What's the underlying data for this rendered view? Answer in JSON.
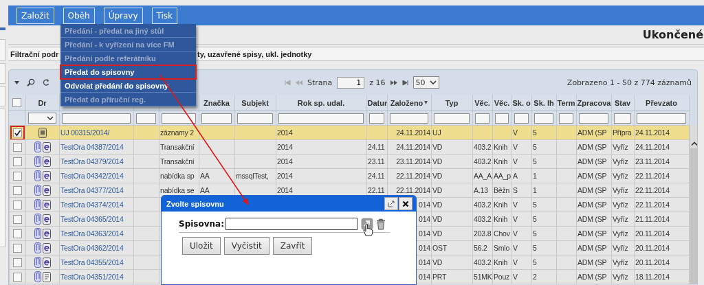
{
  "toolbar": {
    "buttons": [
      "Založit",
      "Oběh",
      "Úpravy",
      "Tisk"
    ]
  },
  "menu": {
    "items": [
      {
        "label": "Předání - předat na jiný stůl",
        "disabled": true,
        "selected": false
      },
      {
        "label": "Předání - k vyřízení na více FM",
        "disabled": true,
        "selected": false
      },
      {
        "label": "Předání podle referátníku",
        "disabled": true,
        "selected": false
      },
      {
        "label": "Předat do spisovny",
        "disabled": false,
        "selected": true
      },
      {
        "label": "Odvolat předání do spisovny",
        "disabled": false,
        "selected": false
      },
      {
        "label": "Předat do příruční reg.",
        "disabled": true,
        "selected": false
      }
    ]
  },
  "page_title": "Ukončené",
  "filter": {
    "parts": [
      "Filtrační podr",
      "ty, uzavřené spisy, ukl. jednotky"
    ]
  },
  "grid": {
    "pager": {
      "page_label": "Strana",
      "page": "1",
      "page_count": "z 16",
      "page_size": "50",
      "summary": "Zobrazeno 1 - 50 z 774 záznamů"
    },
    "columns": [
      {
        "kind": "checkbox",
        "checked": false
      },
      {
        "label": "Dr",
        "kind": "icons"
      },
      {
        "kind": "link"
      },
      {
        "kind": "text"
      },
      {
        "kind": "text"
      },
      {
        "label": "Značka",
        "kind": "text"
      },
      {
        "label": "Subjekt",
        "kind": "text"
      },
      {
        "label": "Rok sp. udal.",
        "kind": "text"
      },
      {
        "label": "Datur",
        "kind": "text"
      },
      {
        "label": "Založeno",
        "kind": "text",
        "sorted": true
      },
      {
        "label": "Typ",
        "kind": "text"
      },
      {
        "label": "Věc.",
        "kind": "text"
      },
      {
        "label": "Věc.",
        "kind": "text"
      },
      {
        "label": "Sk. o",
        "kind": "text"
      },
      {
        "label": "Sk. lh",
        "kind": "text"
      },
      {
        "label": "Term",
        "kind": "text"
      },
      {
        "label": "Zpracova",
        "kind": "text"
      },
      {
        "label": "Stav",
        "kind": "text"
      },
      {
        "label": "Převzato",
        "kind": "text"
      }
    ],
    "rows": [
      {
        "selected": true,
        "cells": [
          {
            "checked": true
          },
          {
            "icons": [
              {
                "kind": "unit"
              }
            ]
          },
          "UJ 00315/2014/",
          "",
          "záznamy 2",
          "",
          "",
          "2014",
          "",
          "24.11.2014",
          "UJ",
          "",
          "",
          "V",
          "5",
          "",
          "ADM (SP",
          "Přípra",
          "24.11.2014"
        ]
      },
      {
        "selected": false,
        "cells": [
          {
            "checked": false
          },
          {
            "icons": [
              {
                "kind": "clip"
              },
              {
                "kind": "e"
              }
            ]
          },
          "TestOra 04387/2014",
          "",
          "Transakční",
          "",
          "",
          "2014",
          "24.11",
          "24.11.2014",
          "VD",
          "403.2",
          "Knih",
          "V",
          "5",
          "",
          "ADM (SP",
          "Vyříz",
          "24.11.2014"
        ]
      },
      {
        "selected": false,
        "cells": [
          {
            "checked": false
          },
          {
            "icons": [
              {
                "kind": "clip"
              },
              {
                "kind": "e"
              }
            ]
          },
          "TestOra 04379/2014",
          "",
          "Transakční",
          "",
          "",
          "2014",
          "23.11",
          "23.11.2014",
          "VD",
          "403.2",
          "Knih",
          "V",
          "5",
          "",
          "ADM (SP",
          "Vyříz",
          "23.11.2014"
        ]
      },
      {
        "selected": false,
        "cells": [
          {
            "checked": false
          },
          {
            "icons": [
              {
                "kind": "clip"
              },
              {
                "kind": "e"
              }
            ]
          },
          "TestOra 04342/2014",
          "",
          "nabídka sp",
          "AA",
          "mssqlTest,",
          "2014",
          "24.11",
          "22.11.2014",
          "VD",
          "AA_A",
          "AA_p",
          "A",
          "1",
          "",
          "ADM (SP",
          "Vyříz",
          "22.11.2014"
        ]
      },
      {
        "selected": false,
        "cells": [
          {
            "checked": false
          },
          {
            "icons": [
              {
                "kind": "clip"
              },
              {
                "kind": "e"
              }
            ]
          },
          "TestOra 04377/2014",
          "",
          "nabídka se",
          "AA",
          "",
          "2014",
          "22.11",
          "22.11.2014",
          "VD",
          "A.13",
          "Běžn",
          "S",
          "1",
          "",
          "ADM (SP",
          "Vyříz",
          "22.11.2014"
        ]
      },
      {
        "selected": false,
        "cells": [
          {
            "checked": false
          },
          {
            "icons": [
              {
                "kind": "clip"
              },
              {
                "kind": "e"
              }
            ]
          },
          "TestOra 04374/2014",
          "",
          "",
          "",
          "",
          "",
          "",
          "014",
          "VD",
          "403.2",
          "Knih",
          "V",
          "5",
          "",
          "ADM (SP",
          "Vyříz",
          "22.11.2014"
        ]
      },
      {
        "selected": false,
        "cells": [
          {
            "checked": false
          },
          {
            "icons": [
              {
                "kind": "clip"
              },
              {
                "kind": "e"
              }
            ]
          },
          "TestOra 04365/2014",
          "",
          "",
          "",
          "",
          "",
          "",
          "014",
          "VD",
          "403.2",
          "Knih",
          "V",
          "5",
          "",
          "ADM (SP",
          "Vyříz",
          "21.11.2014"
        ]
      },
      {
        "selected": false,
        "cells": [
          {
            "checked": false
          },
          {
            "icons": [
              {
                "kind": "clip"
              },
              {
                "kind": "e"
              }
            ]
          },
          "TestOra 04363/2014",
          "",
          "",
          "",
          "",
          "",
          "",
          "014",
          "VD",
          "203.8",
          "Chov",
          "V",
          "5",
          "",
          "ADM (SP",
          "Vyříz",
          "20.11.2014"
        ]
      },
      {
        "selected": false,
        "cells": [
          {
            "checked": false
          },
          {
            "icons": [
              {
                "kind": "clip"
              },
              {
                "kind": "e"
              }
            ]
          },
          "TestOra 04362/2014",
          "",
          "",
          "",
          "",
          "",
          "",
          "014",
          "OST",
          "56.2",
          "Smlo",
          "V",
          "5",
          "",
          "ADM (SP",
          "Vyříz",
          "20.11.2014"
        ]
      },
      {
        "selected": false,
        "cells": [
          {
            "checked": false
          },
          {
            "icons": [
              {
                "kind": "clip"
              },
              {
                "kind": "e"
              }
            ]
          },
          "TestOra 04355/2014",
          "",
          "",
          "",
          "",
          "",
          "",
          "014",
          "VD",
          "403.2",
          "Knih",
          "V",
          "5",
          "",
          "ADM (SP",
          "Vyříz",
          "20.11.2014"
        ]
      },
      {
        "selected": false,
        "cells": [
          {
            "checked": false
          },
          {
            "icons": [
              {
                "kind": "clip"
              },
              {
                "kind": "document"
              }
            ]
          },
          "TestOra 04351/2014",
          "",
          "",
          "",
          "",
          "",
          "",
          "014",
          "PRT",
          "51MK",
          "Pouz",
          "V",
          "2",
          "",
          "ADM (SP",
          "Vyříz",
          "18.11.2014"
        ]
      }
    ]
  },
  "dialog": {
    "title": "Zvolte spisovnu",
    "field_label": "Spisovna:",
    "buttons": [
      "Uložit",
      "Vyčistit",
      "Zavřít"
    ]
  }
}
